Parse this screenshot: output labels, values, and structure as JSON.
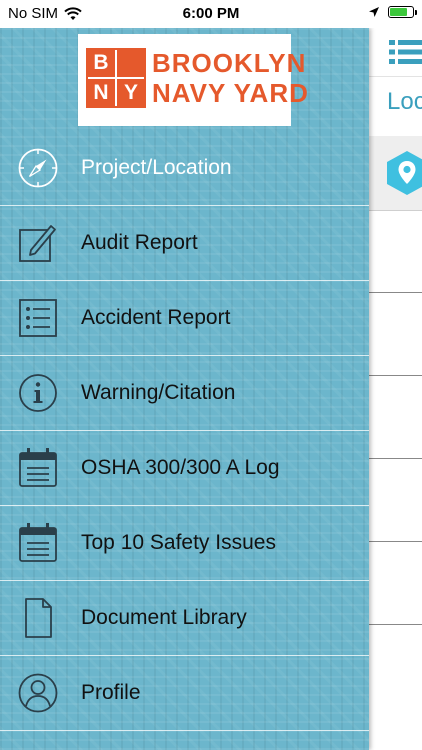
{
  "status_bar": {
    "carrier": "No SIM",
    "time": "6:00 PM",
    "battery_level": 0.8,
    "battery_color": "#3cc83c"
  },
  "logo": {
    "letters": [
      "B",
      "N",
      "Y",
      ""
    ],
    "line1": "BROOKLYN",
    "line2": "NAVY YARD",
    "brand_color": "#e5592c"
  },
  "drawer": {
    "background": "#6cb6cc",
    "items": [
      {
        "label": "Project/Location",
        "icon": "compass-icon",
        "active": true
      },
      {
        "label": "Audit Report",
        "icon": "edit-icon",
        "active": false
      },
      {
        "label": "Accident Report",
        "icon": "checklist-icon",
        "active": false
      },
      {
        "label": "Warning/Citation",
        "icon": "info-icon",
        "active": false
      },
      {
        "label": "OSHA 300/300 A Log",
        "icon": "calendar-icon",
        "active": false
      },
      {
        "label": "Top 10 Safety Issues",
        "icon": "calendar-icon",
        "active": false
      },
      {
        "label": "Document Library",
        "icon": "document-icon",
        "active": false
      },
      {
        "label": "Profile",
        "icon": "user-icon",
        "active": false
      }
    ]
  },
  "content": {
    "title": "Loc",
    "accent": "#3a9fbd",
    "menu_icon": "list-icon",
    "pin_icon": "location-pin-icon"
  }
}
